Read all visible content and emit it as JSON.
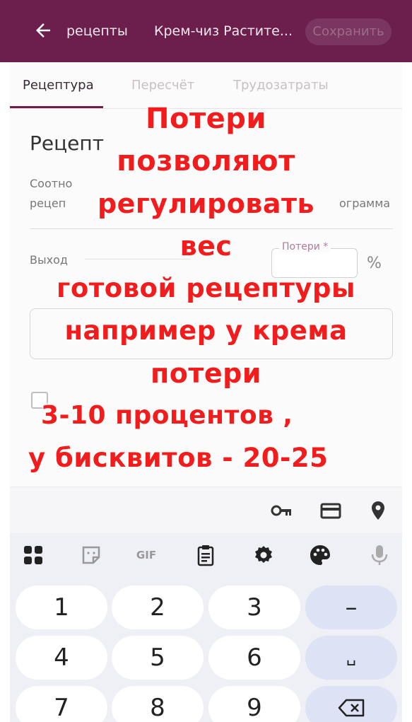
{
  "appbar": {
    "back_icon": "arrow-left-icon",
    "breadcrumb": "рецепты",
    "title": "Крем-чиз Растите...",
    "save_label": "Сохранить"
  },
  "tabs": [
    {
      "label": "Рецептура",
      "active": true
    },
    {
      "label": "Пересчёт",
      "active": false
    },
    {
      "label": "Трудозатраты",
      "active": false
    }
  ],
  "recipe": {
    "section_title": "Рецепт",
    "desc_line1": "Соотно",
    "desc_line2": "рецеп",
    "desc_tail": "ограмма",
    "output_label": "Выход",
    "loss_label": "Потери *",
    "percent_symbol": "%"
  },
  "overlay_lines": [
    "Потери",
    "позволяют",
    "регулировать",
    "вес",
    "готовой рецептуры",
    "например у крема",
    "потери",
    "3-10 процентов ,",
    "у бисквитов - 20-25"
  ],
  "autofill": {
    "icons": [
      "key-icon",
      "credit-card-icon",
      "location-pin-icon"
    ]
  },
  "keyboard": {
    "toolbar_icons": [
      "apps-grid-icon",
      "sticker-icon",
      "gif-icon",
      "clipboard-icon",
      "settings-icon",
      "palette-icon",
      "microphone-icon"
    ],
    "gif_label": "GIF",
    "keys": {
      "k1": "1",
      "k2": "2",
      "k3": "3",
      "minus": "–",
      "k4": "4",
      "k5": "5",
      "k6": "6",
      "space": "␣",
      "k7": "7",
      "k8": "8",
      "k9": "9",
      "backspace_icon": "backspace-icon"
    }
  },
  "colors": {
    "appbar": "#6c1f4d",
    "overlay_text": "#f21c1c",
    "keyboard_bg": "#eff0f5",
    "side_key": "#dde2f4"
  }
}
